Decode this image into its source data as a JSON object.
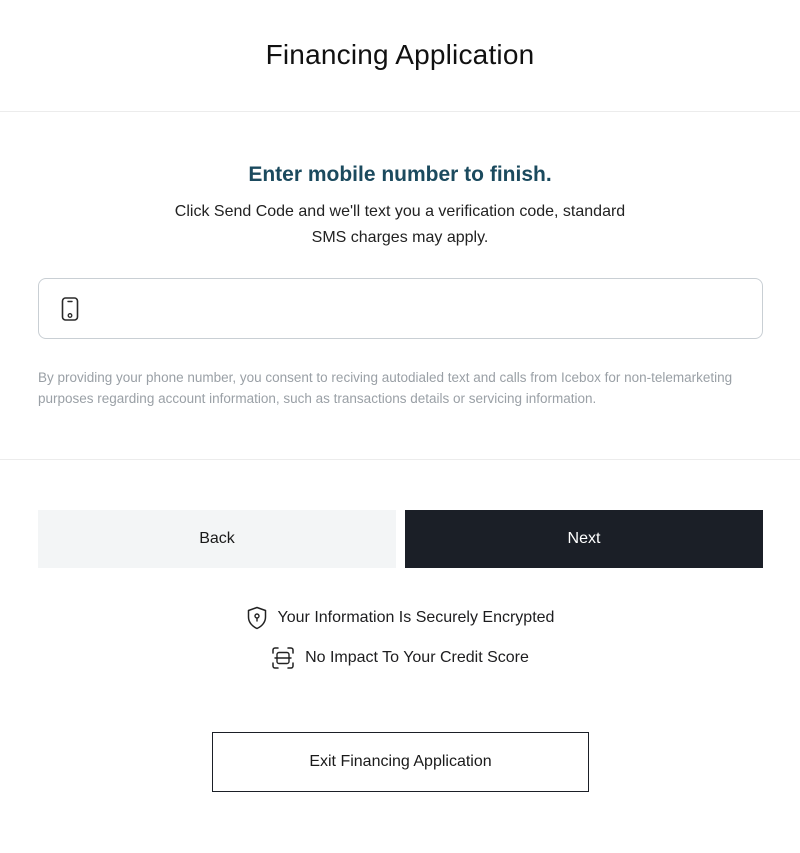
{
  "header": {
    "title": "Financing Application"
  },
  "form": {
    "subtitle": "Enter mobile number to finish.",
    "description": "Click Send Code and we'll text you a verification code, standard SMS charges may apply.",
    "phone_input": {
      "value": "",
      "placeholder": "",
      "icon": "mobile-phone-icon"
    },
    "consent": "By providing your phone number, you consent to reciving autodialed text and calls from Icebox for non-telemarketing purposes regarding account information, such as transactions details or servicing information."
  },
  "actions": {
    "back_label": "Back",
    "next_label": "Next"
  },
  "trust": [
    {
      "label": "Your Information Is Securely Encrypted",
      "icon": "shield-lock-icon"
    },
    {
      "label": "No Impact To Your Credit Score",
      "icon": "credit-card-scan-icon"
    }
  ],
  "exit": {
    "label": "Exit Financing Application"
  },
  "colors": {
    "subtitle": "#1b4a5e",
    "primary_button": "#1b1f27",
    "secondary_button": "#f3f5f6",
    "muted_text": "#9aa0a6"
  }
}
